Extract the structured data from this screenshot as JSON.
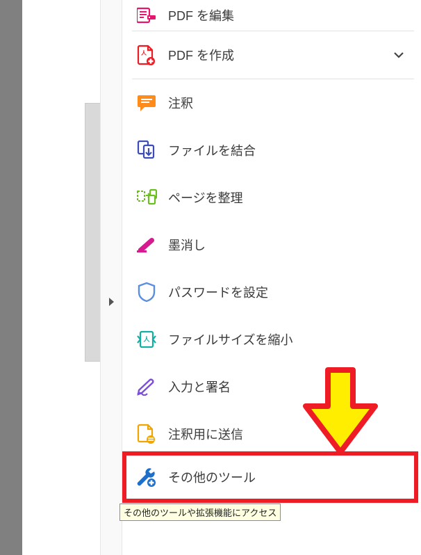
{
  "tools": {
    "edit_pdf": "PDF を編集",
    "create_pdf": "PDF を作成",
    "comments": "注釈",
    "combine_files": "ファイルを結合",
    "organize_pages": "ページを整理",
    "redact": "墨消し",
    "protect": "パスワードを設定",
    "compress": "ファイルサイズを縮小",
    "fill_sign": "入力と署名",
    "send_comments": "注釈用に送信",
    "more_tools": "その他のツール"
  },
  "tooltip": "その他のツールや拡張機能にアクセス"
}
